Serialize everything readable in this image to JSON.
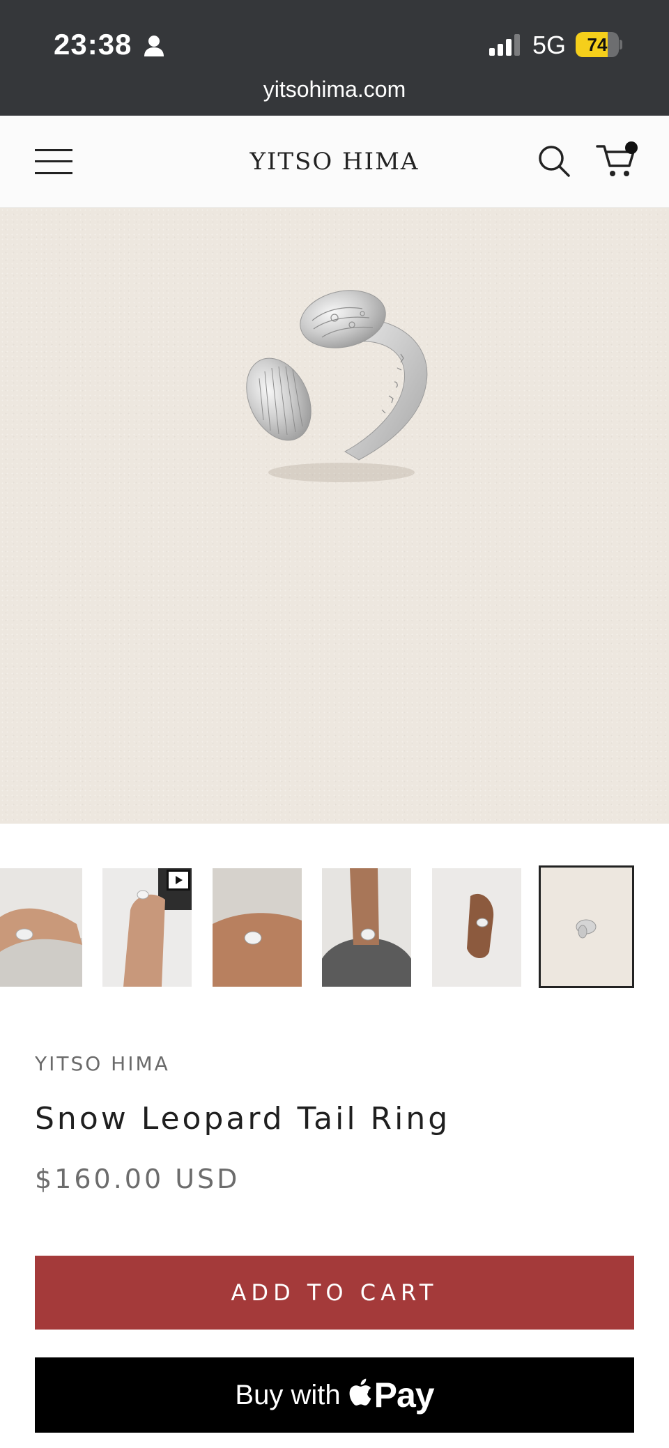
{
  "status_bar": {
    "time": "23:38",
    "network": "5G",
    "battery_level": "74",
    "battery_fraction": 0.74
  },
  "browser": {
    "url": "yitsohima.com"
  },
  "header": {
    "brand": "YITSO HIMA",
    "icons": [
      "menu-icon",
      "search-icon",
      "cart-icon"
    ]
  },
  "gallery": {
    "thumbnail_count": 6,
    "selected_index": 5,
    "video_thumbnail_index": 1
  },
  "product": {
    "vendor": "YITSO HIMA",
    "title": "Snow Leopard Tail Ring",
    "price": "$160.00 USD"
  },
  "actions": {
    "add_to_cart": "ADD TO CART",
    "buy_with": "Buy with",
    "pay": "Pay"
  },
  "colors": {
    "add_to_cart_bg": "#a43a3a",
    "buy_now_bg": "#000000",
    "status_bar_bg": "#35373a",
    "battery_fill": "#f5cf1b"
  }
}
